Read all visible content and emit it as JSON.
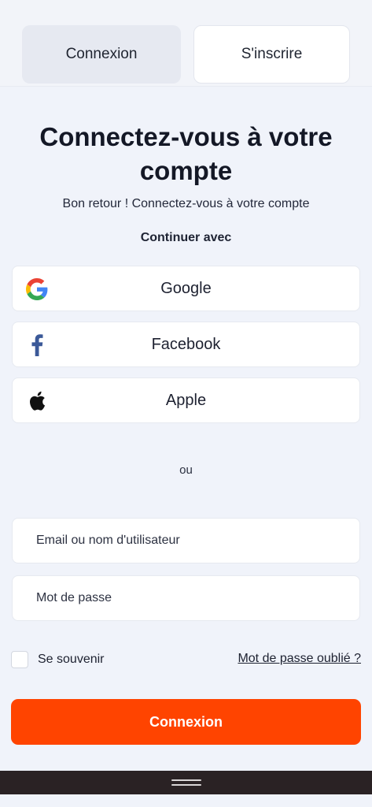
{
  "tabs": {
    "login_label": "Connexion",
    "signup_label": "S'inscrire"
  },
  "header": {
    "title": "Connectez-vous à votre compte",
    "subtitle": "Bon retour ! Connectez-vous à votre compte",
    "continue_with": "Continuer avec"
  },
  "social": {
    "google": {
      "label": "Google",
      "icon": "google-icon"
    },
    "facebook": {
      "label": "Facebook",
      "icon": "facebook-icon",
      "color": "#3b5998"
    },
    "apple": {
      "label": "Apple",
      "icon": "apple-icon"
    }
  },
  "divider": {
    "label": "ou"
  },
  "form": {
    "email_placeholder": "Email ou nom d'utilisateur",
    "password_placeholder": "Mot de passe",
    "remember_label": "Se souvenir",
    "remember_checked": false,
    "forgot_label": "Mot de passe oublié ?",
    "submit_label": "Connexion"
  },
  "colors": {
    "accent": "#ff4400",
    "background": "#f0f3fa",
    "nav_bar": "#2a2224"
  }
}
